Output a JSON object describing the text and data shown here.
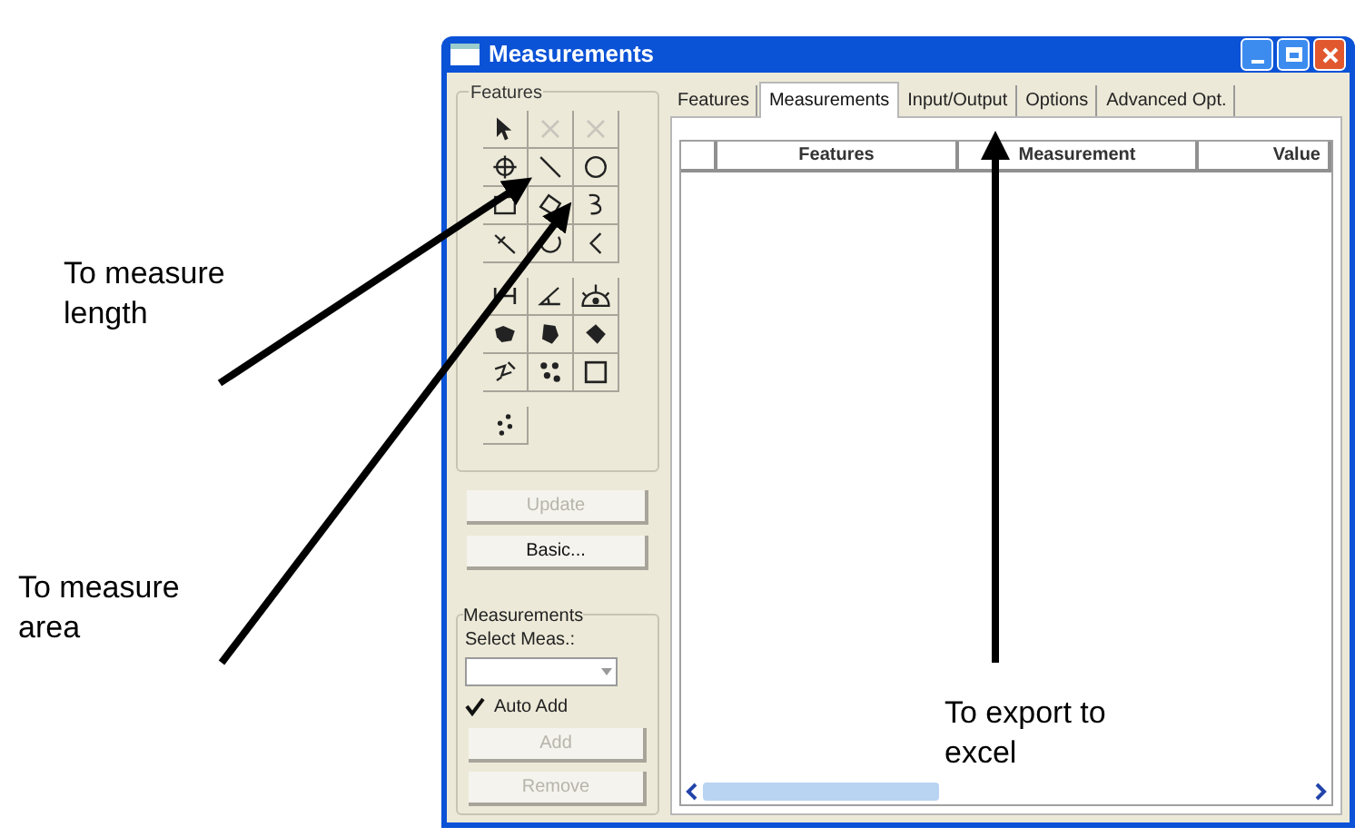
{
  "window": {
    "title": "Measurements"
  },
  "features_group": {
    "label": "Features",
    "tool_rows": [
      {
        "tools": [
          {
            "disabled": false
          },
          {
            "disabled": true
          },
          {
            "disabled": true
          }
        ]
      },
      {
        "tools": [
          {
            "disabled": false
          },
          {
            "disabled": false
          },
          {
            "disabled": false
          }
        ]
      },
      {
        "tools": [
          {
            "disabled": false
          },
          {
            "disabled": false
          },
          {
            "disabled": false
          }
        ]
      },
      {
        "tools": [
          {
            "disabled": false
          },
          {
            "disabled": false
          },
          {
            "disabled": false
          }
        ]
      },
      {
        "tools": [
          {
            "disabled": false
          },
          {
            "disabled": false
          },
          {
            "disabled": false
          }
        ]
      },
      {
        "tools": [
          {
            "disabled": false
          },
          {
            "disabled": false
          },
          {
            "disabled": false
          }
        ]
      },
      {
        "tools": [
          {
            "disabled": false
          },
          {
            "disabled": false
          },
          {
            "disabled": false
          }
        ]
      },
      {
        "tools": [
          {
            "disabled": false
          }
        ]
      }
    ]
  },
  "buttons": [
    {
      "label": "Update",
      "disabled": true
    },
    {
      "label": "Basic...",
      "disabled": false
    }
  ],
  "measurements_group": {
    "label": "Measurements",
    "select_label": "Select Meas.:",
    "auto_add": {
      "label": "Auto Add",
      "checked": true
    },
    "buttons": [
      {
        "label": "Add",
        "disabled": true
      },
      {
        "label": "Remove",
        "disabled": true
      }
    ]
  },
  "tabs": [
    {
      "label": "Features",
      "selected": false
    },
    {
      "label": "Measurements",
      "selected": true
    },
    {
      "label": "Input/Output",
      "selected": false
    },
    {
      "label": "Options",
      "selected": false
    },
    {
      "label": "Advanced Opt.",
      "selected": false
    }
  ],
  "table": {
    "columns": [
      "",
      "Features",
      "Measurement",
      "Value"
    ]
  },
  "annotations": [
    {
      "text": "To measure length"
    },
    {
      "text": "To measure area"
    },
    {
      "text": "To export to excel"
    }
  ]
}
